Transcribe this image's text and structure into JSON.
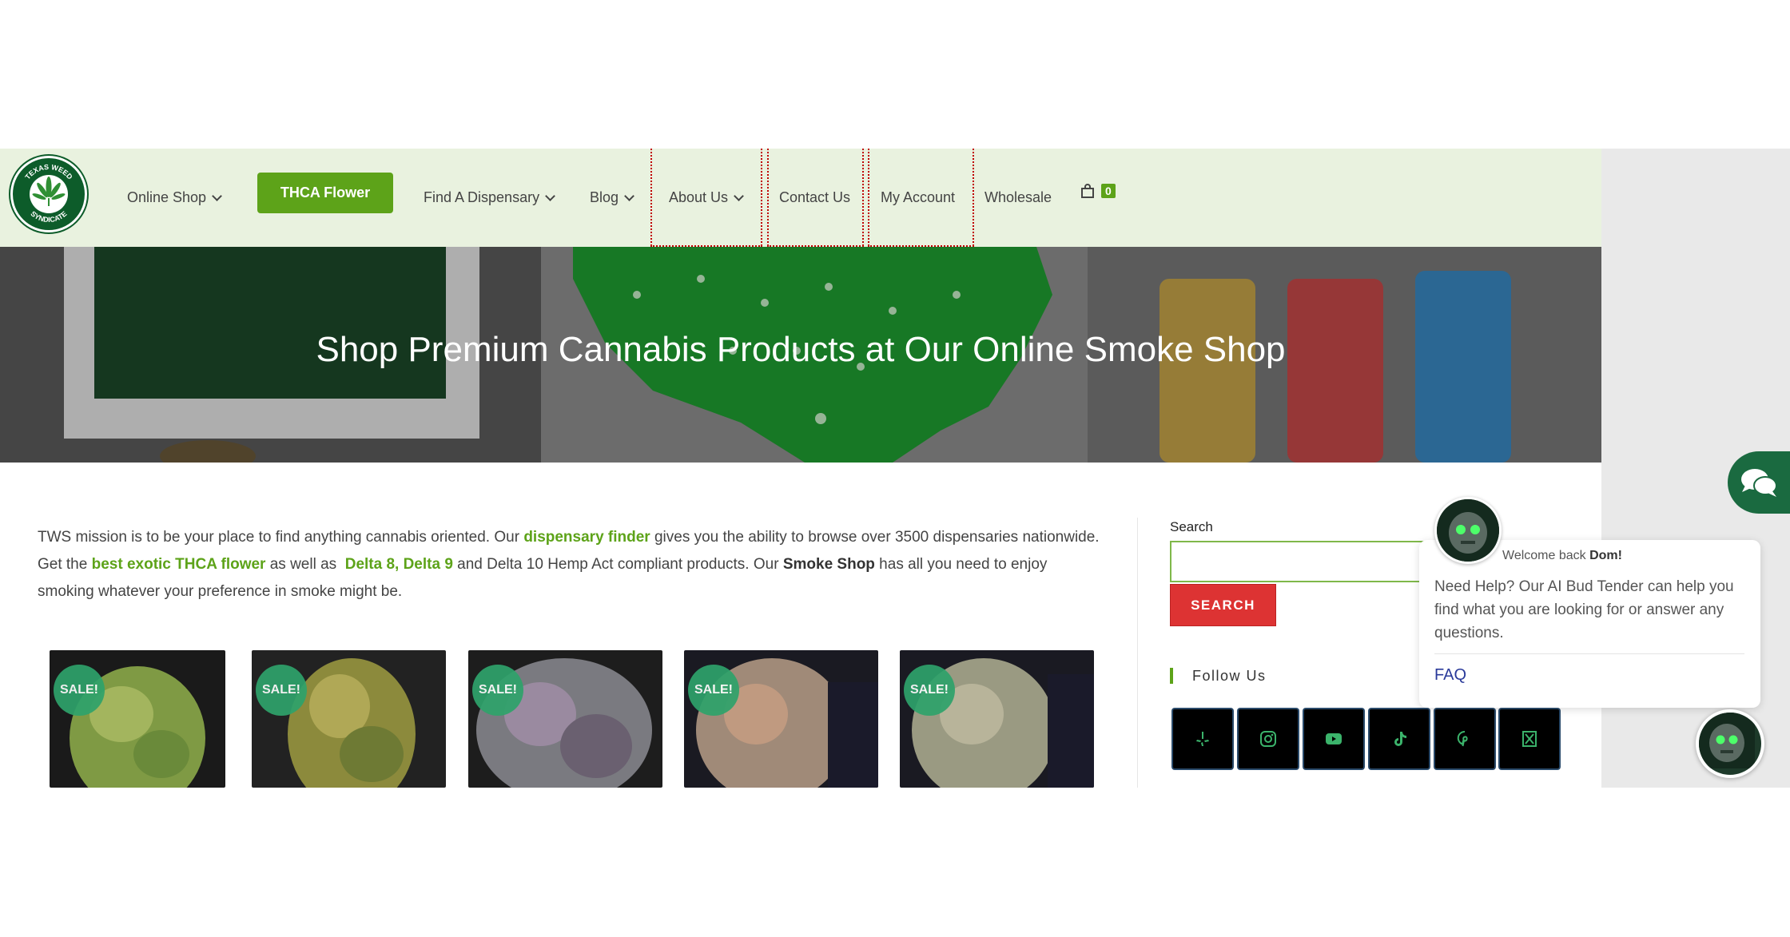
{
  "brand": {
    "logo_top": "TEXAS WEED",
    "logo_bottom": "SYNDICATE",
    "green": "#5da319",
    "header_bg": "#e9f2df"
  },
  "nav": {
    "online_shop": "Online Shop",
    "thca_flower": "THCA Flower",
    "find_dispensary": "Find A Dispensary",
    "blog": "Blog",
    "about_us": "About Us",
    "contact_us": "Contact Us",
    "my_account": "My Account",
    "wholesale": "Wholesale",
    "cart_count": "0"
  },
  "hero": {
    "title": "Shop Premium Cannabis Products at Our Online Smoke Shop"
  },
  "mission": {
    "t1": "TWS mission is to be your place to find anything cannabis oriented. Our ",
    "link1": "dispensary finder",
    "t2": " gives you the ability to browse over 3500 dispensaries nationwide. Get the ",
    "link2": "best exotic THCA flower",
    "t3": " as well as  ",
    "link3": "Delta 8, Delta 9",
    "t4": " and Delta 10 Hemp Act compliant products. Our ",
    "bold": "Smoke Shop",
    "t5": " has all you need to enjoy smoking whatever your preference in smoke might be."
  },
  "products": [
    {
      "badge": "SALE!"
    },
    {
      "badge": "SALE!"
    },
    {
      "badge": "SALE!"
    },
    {
      "badge": "SALE!"
    },
    {
      "badge": "SALE!"
    }
  ],
  "sidebar": {
    "search_label": "Search",
    "search_value": "",
    "search_button": "SEARCH",
    "follow_us": "Follow Us",
    "social": [
      "yelp-icon",
      "instagram-icon",
      "youtube-icon",
      "tiktok-icon",
      "pinterest-icon",
      "x-icon"
    ]
  },
  "chat": {
    "welcome_prefix": "Welcome back ",
    "welcome_name": "Dom!",
    "message": "Need Help? Our AI Bud Tender can help you find what you are looking for or answer any questions.",
    "faq": "FAQ"
  }
}
